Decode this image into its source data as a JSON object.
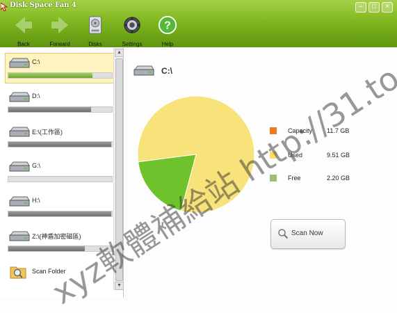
{
  "window": {
    "title": "Disk Space Fan 4",
    "buttons": [
      "–",
      "□",
      "×"
    ]
  },
  "toolbar": {
    "items": [
      {
        "label": "Back",
        "icon": "back-arrow-icon"
      },
      {
        "label": "Forward",
        "icon": "forward-arrow-icon"
      },
      {
        "label": "Disks",
        "icon": "disk-drive-icon"
      },
      {
        "label": "Settings",
        "icon": "gear-icon"
      },
      {
        "label": "Help",
        "icon": "help-icon"
      }
    ]
  },
  "sidebar": {
    "drives": [
      {
        "label": "C:\\",
        "used_fraction": 0.81,
        "selected": true
      },
      {
        "label": "D:\\",
        "used_fraction": 0.8
      },
      {
        "label": "E:\\(工作區)",
        "used_fraction": 0.99
      },
      {
        "label": "G:\\",
        "used_fraction": 0.0
      },
      {
        "label": "H:\\",
        "used_fraction": 0.99
      },
      {
        "label": "Z:\\(神盾加密磁區)",
        "used_fraction": 0.74
      }
    ],
    "scan_folder_label": "Scan Folder"
  },
  "main": {
    "drive_title": "C:\\",
    "legend": [
      {
        "name": "Capacity",
        "value": "11.7 GB",
        "color": "#f07a1e"
      },
      {
        "name": "Used",
        "value": "9.51 GB",
        "color": "#f7dd6b"
      },
      {
        "name": "Free",
        "value": "2.20 GB",
        "color": "#9dbc74"
      }
    ],
    "scan_now_label": "Scan Now"
  },
  "chart_data": {
    "type": "pie",
    "slices": [
      {
        "name": "Used",
        "value": 9.51,
        "color": "#f8e27a"
      },
      {
        "name": "Free",
        "value": 2.2,
        "color": "#6ec22c"
      }
    ]
  },
  "watermark": "xyz軟體補給站 http://31.to"
}
